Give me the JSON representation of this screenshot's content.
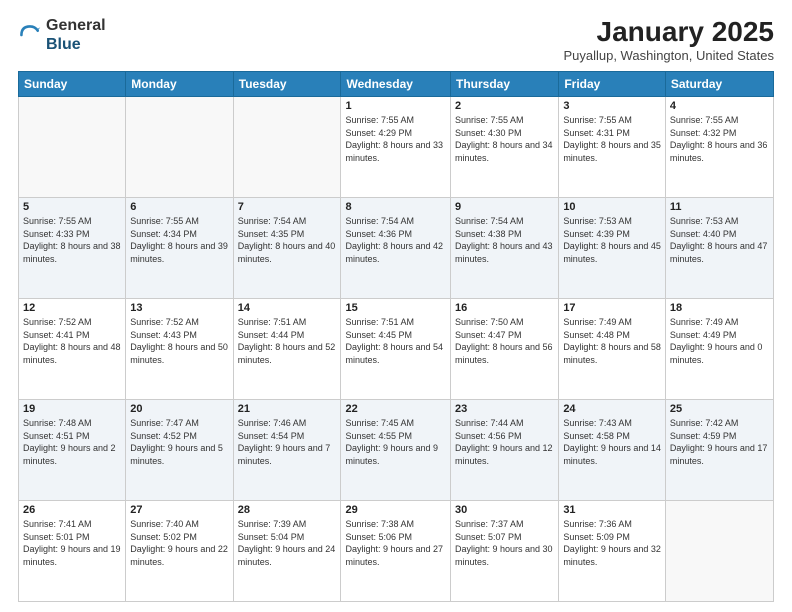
{
  "header": {
    "logo_line1": "General",
    "logo_line2": "Blue",
    "title": "January 2025",
    "subtitle": "Puyallup, Washington, United States"
  },
  "days_of_week": [
    "Sunday",
    "Monday",
    "Tuesday",
    "Wednesday",
    "Thursday",
    "Friday",
    "Saturday"
  ],
  "weeks": [
    [
      {
        "date": "",
        "info": ""
      },
      {
        "date": "",
        "info": ""
      },
      {
        "date": "",
        "info": ""
      },
      {
        "date": "1",
        "info": "Sunrise: 7:55 AM\nSunset: 4:29 PM\nDaylight: 8 hours\nand 33 minutes."
      },
      {
        "date": "2",
        "info": "Sunrise: 7:55 AM\nSunset: 4:30 PM\nDaylight: 8 hours\nand 34 minutes."
      },
      {
        "date": "3",
        "info": "Sunrise: 7:55 AM\nSunset: 4:31 PM\nDaylight: 8 hours\nand 35 minutes."
      },
      {
        "date": "4",
        "info": "Sunrise: 7:55 AM\nSunset: 4:32 PM\nDaylight: 8 hours\nand 36 minutes."
      }
    ],
    [
      {
        "date": "5",
        "info": "Sunrise: 7:55 AM\nSunset: 4:33 PM\nDaylight: 8 hours\nand 38 minutes."
      },
      {
        "date": "6",
        "info": "Sunrise: 7:55 AM\nSunset: 4:34 PM\nDaylight: 8 hours\nand 39 minutes."
      },
      {
        "date": "7",
        "info": "Sunrise: 7:54 AM\nSunset: 4:35 PM\nDaylight: 8 hours\nand 40 minutes."
      },
      {
        "date": "8",
        "info": "Sunrise: 7:54 AM\nSunset: 4:36 PM\nDaylight: 8 hours\nand 42 minutes."
      },
      {
        "date": "9",
        "info": "Sunrise: 7:54 AM\nSunset: 4:38 PM\nDaylight: 8 hours\nand 43 minutes."
      },
      {
        "date": "10",
        "info": "Sunrise: 7:53 AM\nSunset: 4:39 PM\nDaylight: 8 hours\nand 45 minutes."
      },
      {
        "date": "11",
        "info": "Sunrise: 7:53 AM\nSunset: 4:40 PM\nDaylight: 8 hours\nand 47 minutes."
      }
    ],
    [
      {
        "date": "12",
        "info": "Sunrise: 7:52 AM\nSunset: 4:41 PM\nDaylight: 8 hours\nand 48 minutes."
      },
      {
        "date": "13",
        "info": "Sunrise: 7:52 AM\nSunset: 4:43 PM\nDaylight: 8 hours\nand 50 minutes."
      },
      {
        "date": "14",
        "info": "Sunrise: 7:51 AM\nSunset: 4:44 PM\nDaylight: 8 hours\nand 52 minutes."
      },
      {
        "date": "15",
        "info": "Sunrise: 7:51 AM\nSunset: 4:45 PM\nDaylight: 8 hours\nand 54 minutes."
      },
      {
        "date": "16",
        "info": "Sunrise: 7:50 AM\nSunset: 4:47 PM\nDaylight: 8 hours\nand 56 minutes."
      },
      {
        "date": "17",
        "info": "Sunrise: 7:49 AM\nSunset: 4:48 PM\nDaylight: 8 hours\nand 58 minutes."
      },
      {
        "date": "18",
        "info": "Sunrise: 7:49 AM\nSunset: 4:49 PM\nDaylight: 9 hours\nand 0 minutes."
      }
    ],
    [
      {
        "date": "19",
        "info": "Sunrise: 7:48 AM\nSunset: 4:51 PM\nDaylight: 9 hours\nand 2 minutes."
      },
      {
        "date": "20",
        "info": "Sunrise: 7:47 AM\nSunset: 4:52 PM\nDaylight: 9 hours\nand 5 minutes."
      },
      {
        "date": "21",
        "info": "Sunrise: 7:46 AM\nSunset: 4:54 PM\nDaylight: 9 hours\nand 7 minutes."
      },
      {
        "date": "22",
        "info": "Sunrise: 7:45 AM\nSunset: 4:55 PM\nDaylight: 9 hours\nand 9 minutes."
      },
      {
        "date": "23",
        "info": "Sunrise: 7:44 AM\nSunset: 4:56 PM\nDaylight: 9 hours\nand 12 minutes."
      },
      {
        "date": "24",
        "info": "Sunrise: 7:43 AM\nSunset: 4:58 PM\nDaylight: 9 hours\nand 14 minutes."
      },
      {
        "date": "25",
        "info": "Sunrise: 7:42 AM\nSunset: 4:59 PM\nDaylight: 9 hours\nand 17 minutes."
      }
    ],
    [
      {
        "date": "26",
        "info": "Sunrise: 7:41 AM\nSunset: 5:01 PM\nDaylight: 9 hours\nand 19 minutes."
      },
      {
        "date": "27",
        "info": "Sunrise: 7:40 AM\nSunset: 5:02 PM\nDaylight: 9 hours\nand 22 minutes."
      },
      {
        "date": "28",
        "info": "Sunrise: 7:39 AM\nSunset: 5:04 PM\nDaylight: 9 hours\nand 24 minutes."
      },
      {
        "date": "29",
        "info": "Sunrise: 7:38 AM\nSunset: 5:06 PM\nDaylight: 9 hours\nand 27 minutes."
      },
      {
        "date": "30",
        "info": "Sunrise: 7:37 AM\nSunset: 5:07 PM\nDaylight: 9 hours\nand 30 minutes."
      },
      {
        "date": "31",
        "info": "Sunrise: 7:36 AM\nSunset: 5:09 PM\nDaylight: 9 hours\nand 32 minutes."
      },
      {
        "date": "",
        "info": ""
      }
    ]
  ]
}
